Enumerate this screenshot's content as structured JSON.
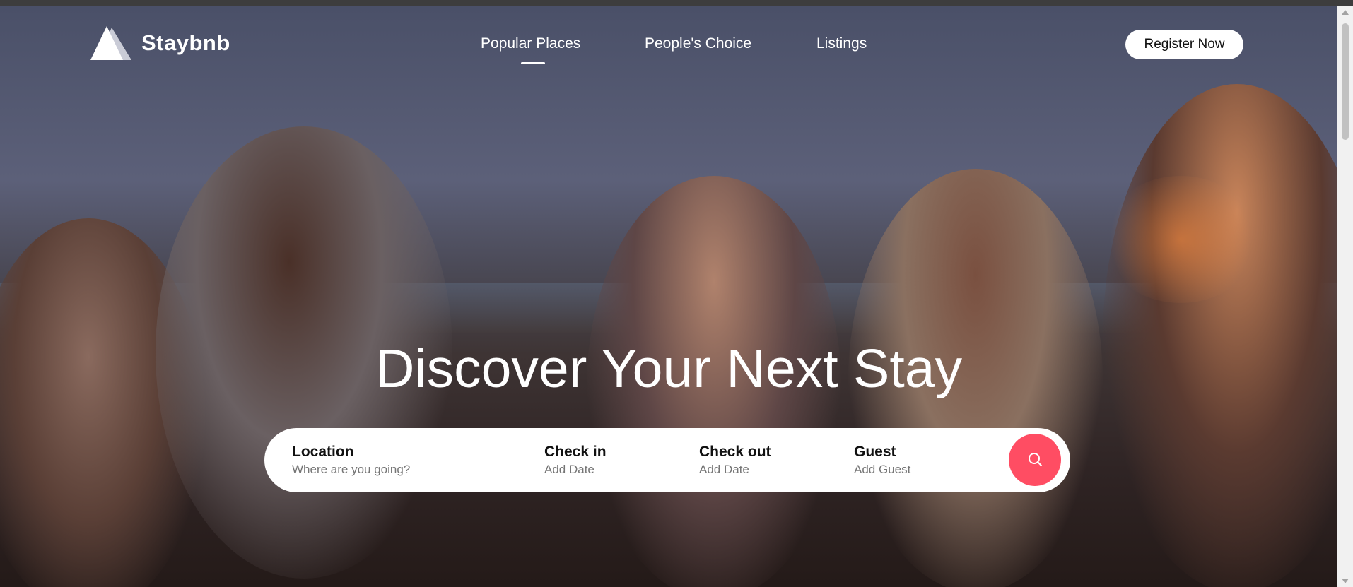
{
  "brand": {
    "name": "Staybnb"
  },
  "nav": {
    "items": [
      {
        "label": "Popular Places",
        "active": true
      },
      {
        "label": "People's Choice",
        "active": false
      },
      {
        "label": "Listings",
        "active": false
      }
    ],
    "register_label": "Register Now"
  },
  "hero": {
    "headline": "Discover Your Next Stay"
  },
  "search": {
    "location": {
      "label": "Location",
      "placeholder": "Where are you going?"
    },
    "check_in": {
      "label": "Check in",
      "placeholder": "Add Date"
    },
    "check_out": {
      "label": "Check out",
      "placeholder": "Add Date"
    },
    "guest": {
      "label": "Guest",
      "placeholder": "Add Guest"
    },
    "button_icon": "search-icon"
  },
  "colors": {
    "accent": "#ff4d63",
    "text_on_hero": "#ffffff",
    "searchbar_bg": "#ffffff"
  }
}
